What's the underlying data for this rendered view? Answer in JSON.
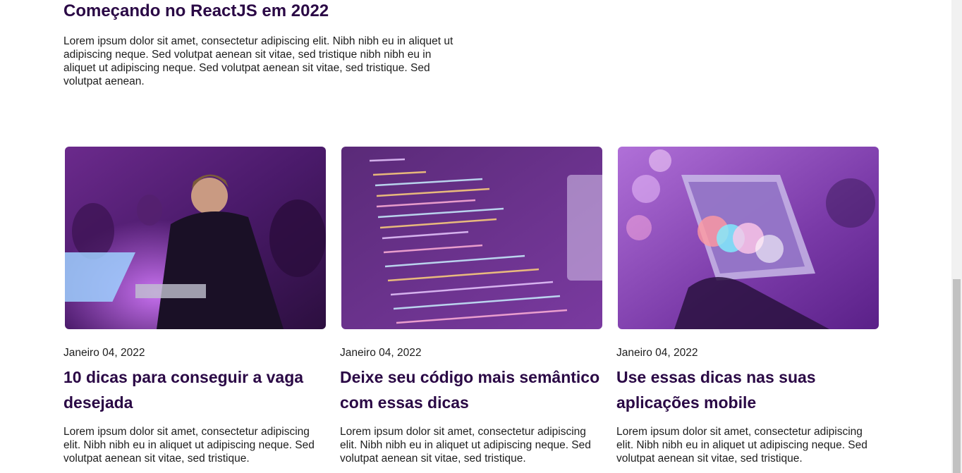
{
  "featured": {
    "title": "Começando no ReactJS em 2022",
    "text": "Lorem ipsum dolor sit amet, consectetur adipiscing elit. Nibh nibh eu in aliquet ut adipiscing neque. Sed volutpat aenean sit vitae, sed tristique nibh nibh eu in aliquet ut adipiscing neque. Sed volutpat aenean sit vitae, sed tristique. Sed volutpat aenean."
  },
  "cards": [
    {
      "image_alt": "person-with-laptop-photo",
      "date": "Janeiro 04, 2022",
      "title": "10 dicas para conseguir a vaga desejada",
      "text": "Lorem ipsum dolor sit amet, consectetur adipiscing elit. Nibh nibh eu in aliquet ut adipiscing neque. Sed volutpat aenean sit vitae, sed tristique."
    },
    {
      "image_alt": "html-code-screen-photo",
      "date": "Janeiro 04, 2022",
      "title": "Deixe seu código mais semântico com essas dicas",
      "text": "Lorem ipsum dolor sit amet, consectetur adipiscing elit. Nibh nibh eu in aliquet ut adipiscing neque. Sed volutpat aenean sit vitae, sed tristique."
    },
    {
      "image_alt": "smartphone-bokeh-photo",
      "date": "Janeiro 04, 2022",
      "title": "Use essas dicas nas suas aplicações mobile",
      "text": "Lorem ipsum dolor sit amet, consectetur adipiscing elit. Nibh nibh eu in aliquet ut adipiscing neque. Sed volutpat aenean sit vitae, sed tristique."
    }
  ],
  "colors": {
    "title": "#2a0845",
    "overlay": "#8a2be2"
  }
}
